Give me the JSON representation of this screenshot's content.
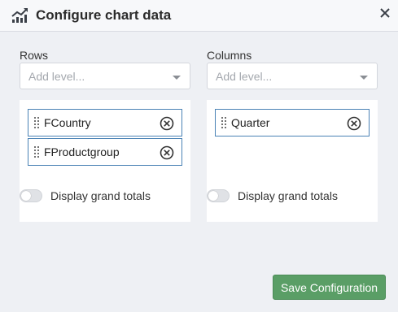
{
  "dialog": {
    "title": "Configure chart data",
    "title_icon": "chart-line-icon",
    "close_icon": "close-icon"
  },
  "rows": {
    "label": "Rows",
    "select_placeholder": "Add level...",
    "items": [
      {
        "label": "FCountry"
      },
      {
        "label": "FProductgroup"
      }
    ],
    "grand_totals_label": "Display grand totals",
    "grand_totals_on": false
  },
  "columns": {
    "label": "Columns",
    "select_placeholder": "Add level...",
    "items": [
      {
        "label": "Quarter"
      }
    ],
    "grand_totals_label": "Display grand totals",
    "grand_totals_on": false
  },
  "footer": {
    "save_label": "Save Configuration"
  },
  "colors": {
    "accent_border": "#4a82b5",
    "save_button": "#5a9e66",
    "background": "#eef0f4"
  }
}
